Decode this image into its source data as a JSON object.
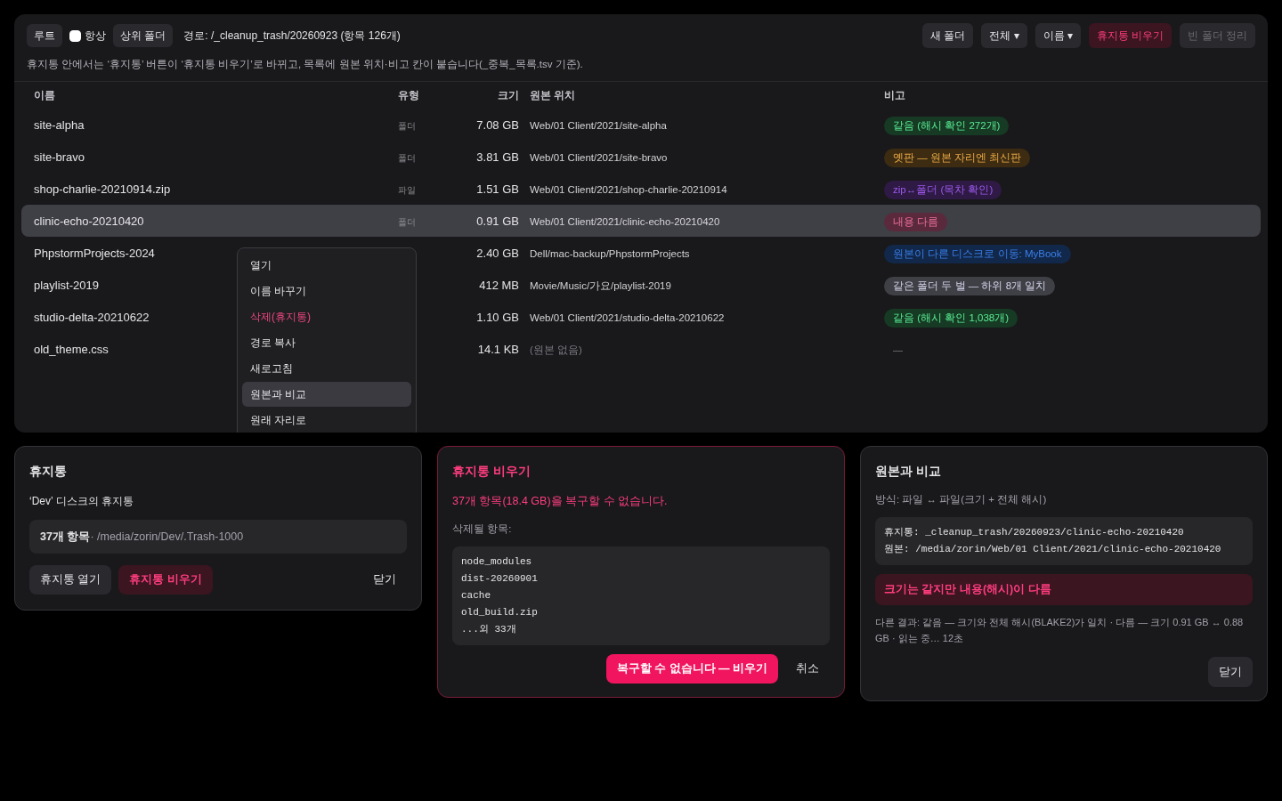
{
  "toolbar": {
    "root_button": "루트",
    "always_checkbox": {
      "label": "항상",
      "checked": false
    },
    "up_button": "상위 폴더",
    "path": "경로: /_cleanup_trash/20260923 (항목 126개)",
    "buttons": [
      {
        "label": "새 폴더",
        "kind": "normal"
      },
      {
        "label": "전체 ▾",
        "kind": "normal"
      },
      {
        "label": "이름 ▾",
        "kind": "normal"
      },
      {
        "label": "휴지통 비우기",
        "kind": "danger"
      },
      {
        "label": "빈 폴더 정리",
        "kind": "disabled"
      }
    ]
  },
  "notice": "휴지통 안에서는 ‘휴지통’ 버튼이 ‘휴지통 비우기’로 바뀌고, 목록에 원본 위치·비고 칸이 붙습니다(_중복_목록.tsv 기준).",
  "table": {
    "columns": [
      "이름",
      "유형",
      "크기",
      "원본 위치",
      "비고"
    ],
    "rows": [
      {
        "name": "site-alpha",
        "type": "폴더",
        "size": "7.08 GB",
        "origin": "Web/01 Client/2021/site-alpha",
        "note": "같음 (해시 확인 272개)",
        "color": "#163a24",
        "selected": false
      },
      {
        "name": "site-bravo",
        "type": "폴더",
        "size": "3.81 GB",
        "origin": "Web/01 Client/2021/site-bravo",
        "note": "옛판 — 원본 자리엔 최신판",
        "color": "#3d2c12",
        "selected": false
      },
      {
        "name": "shop-charlie-20210914.zip",
        "type": "파일",
        "size": "1.51 GB",
        "origin": "Web/01 Client/2021/shop-charlie-20210914",
        "note": "zip↔폴더 (목차 확인)",
        "color": "#2e1a45",
        "selected": false
      },
      {
        "name": "clinic-echo-20210420",
        "type": "폴더",
        "size": "0.91 GB",
        "origin": "Web/01 Client/2021/clinic-echo-20210420",
        "note": "내용 다름",
        "color": "#5a2a3c",
        "selected": true
      },
      {
        "name": "PhpstormProjects-2024",
        "size": "2.40 GB",
        "origin": "Dell/mac-backup/PhpstormProjects",
        "note": "원본이 다른 디스크로 이동: MyBook",
        "color": "#12284a",
        "selected": false
      },
      {
        "name": "playlist-2019",
        "size": "412 MB",
        "origin": "Movie/Music/가요/playlist-2019",
        "note": "같은 폴더 두 벌 — 하위 8개 일치",
        "color": "#3f3f46",
        "selected": false
      },
      {
        "name": "studio-delta-20210622",
        "size": "1.10 GB",
        "origin": "Web/01 Client/2021/studio-delta-20210622",
        "note": "같음 (해시 확인 1,038개)",
        "color": "#163a24",
        "selected": false
      },
      {
        "name": "old_theme.css",
        "size": "14.1 KB",
        "origin": "(원본 없음)",
        "origin_missing": true,
        "dash": "—"
      }
    ]
  },
  "context_menu": [
    {
      "label": "열기",
      "kind": "normal",
      "selected": false
    },
    {
      "label": "이름 바꾸기",
      "kind": "normal",
      "selected": false
    },
    {
      "label": "삭제(휴지통)",
      "kind": "danger",
      "selected": false
    },
    {
      "label": "경로 복사",
      "kind": "normal",
      "selected": false
    },
    {
      "label": "새로고침",
      "kind": "normal",
      "selected": false
    },
    {
      "label": "원본과 비교",
      "kind": "normal",
      "selected": true
    },
    {
      "label": "원래 자리로",
      "kind": "normal",
      "selected": false
    }
  ],
  "trash_card": {
    "title": "휴지통",
    "subtitle": "‘Dev’ 디스크의 휴지통",
    "count": "37개 항목",
    "path": " · /media/zorin/Dev/.Trash-1000",
    "open_button": "휴지통 열기",
    "empty_button": "휴지통 비우기",
    "close_button": "닫기"
  },
  "empty_dialog": {
    "title": "휴지통 비우기",
    "warning": "37개 항목(18.4 GB)을 복구할 수 없습니다.",
    "list_label": "삭제될 항목:",
    "items": [
      "node_modules",
      "dist-20260901",
      "cache",
      "old_build.zip",
      "...외 33개"
    ],
    "confirm_button": "복구할 수 없습니다 — 비우기",
    "cancel_button": "취소"
  },
  "compare_dialog": {
    "title": "원본과 비교",
    "method": "방식: 파일 ↔ 파일(크기 + 전체 해시)",
    "trash_path": "휴지통: _cleanup_trash/20260923/clinic-echo-20210420",
    "origin_path": "원본: /media/zorin/Web/01 Client/2021/clinic-echo-20210420",
    "result": "크기는 같지만 내용(해시)이 다름",
    "legend": "다른 결과: 같음 — 크기와 전체 해시(BLAKE2)가 일치 · 다름 — 크기 0.91 GB ↔ 0.88 GB · 읽는 중… 12초",
    "close_button": "닫기"
  }
}
